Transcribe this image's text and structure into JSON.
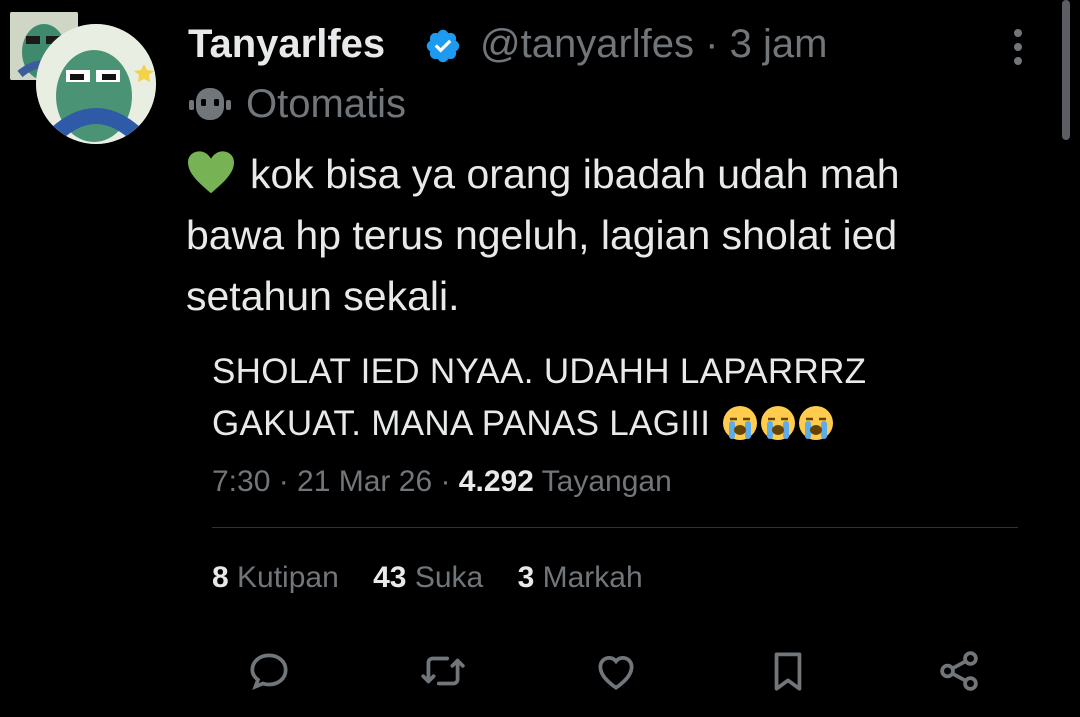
{
  "author": {
    "name": "Tanyarlfes",
    "handle": "@tanyarlfes",
    "time": "· 3 jam",
    "label": "Otomatis"
  },
  "tweet": {
    "line1": "kok bisa ya orang ibadah udah mah",
    "line2": "bawa hp terus ngeluh, lagian sholat ied",
    "line3": "setahun sekali."
  },
  "embed": {
    "line1": "SHOLAT IED NYAA. UDAHH LAPARRRZ",
    "line2": "GAKUAT. MANA PANAS LAGIII",
    "time": "7:30 · 21 Mar 26 ·",
    "views_count": "4.292",
    "views_label": "Tayangan",
    "quotes_count": "8",
    "quotes_label": "Kutipan",
    "likes_count": "43",
    "likes_label": "Suka",
    "bookmarks_count": "3",
    "bookmarks_label": "Markah"
  },
  "icons": {
    "verified": "verified-badge-icon",
    "more": "more-vertical-icon",
    "automated": "robot-icon",
    "heart_emoji": "green-heart-emoji",
    "cry_emoji": "loudly-crying-face-emoji",
    "reply": "reply-icon",
    "retweet": "retweet-icon",
    "like": "like-icon",
    "bookmark": "bookmark-icon",
    "share": "share-icon"
  },
  "colors": {
    "background": "#000000",
    "text": "#e7e9ea",
    "secondary": "#71767b",
    "verified": "#1d9bf0",
    "heart": "#77b255"
  }
}
